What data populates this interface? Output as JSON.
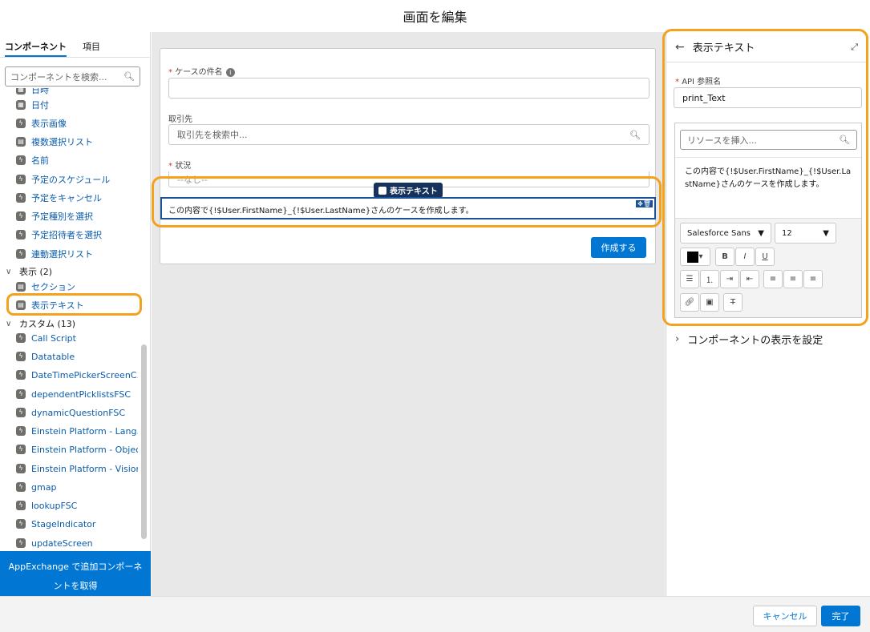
{
  "header": {
    "title": "画面を編集"
  },
  "left": {
    "tabs": [
      "コンポーネント",
      "項目"
    ],
    "search_placeholder": "コンポーネントを検索...",
    "items": [
      {
        "label": "日時"
      },
      {
        "label": "日付"
      },
      {
        "label": "表示画像"
      },
      {
        "label": "複数選択リスト"
      },
      {
        "label": "名前"
      },
      {
        "label": "予定のスケジュール"
      },
      {
        "label": "予定をキャンセル"
      },
      {
        "label": "予定種別を選択"
      },
      {
        "label": "予定招待者を選択"
      },
      {
        "label": "連動選択リスト"
      }
    ],
    "group_display": "表示 (2)",
    "display_items": [
      {
        "label": "セクション"
      },
      {
        "label": "表示テキスト"
      }
    ],
    "group_custom": "カスタム (13)",
    "custom_items": [
      {
        "label": "Call Script"
      },
      {
        "label": "Datatable"
      },
      {
        "label": "DateTimePickerScreenC..."
      },
      {
        "label": "dependentPicklistsFSC"
      },
      {
        "label": "dynamicQuestionFSC"
      },
      {
        "label": "Einstein Platform - Lang..."
      },
      {
        "label": "Einstein Platform - Objec..."
      },
      {
        "label": "Einstein Platform - Vision"
      },
      {
        "label": "gmap"
      },
      {
        "label": "lookupFSC"
      },
      {
        "label": "StageIndicator"
      },
      {
        "label": "updateScreen"
      }
    ],
    "appexchange": "AppExchange で追加コンポーネントを取得"
  },
  "canvas": {
    "case_subject_label": "ケースの件名",
    "account_label": "取引先",
    "account_placeholder": "取引先を検索中...",
    "status_label": "状況",
    "status_value": "--なし--",
    "pill": "表示テキスト",
    "display_text": "この内容で{!$User.FirstName}_{!$User.LastName}さんのケースを作成します。",
    "create_button": "作成する"
  },
  "right": {
    "title": "表示テキスト",
    "api_label": "API 参照名",
    "api_value": "print_Text",
    "resource_placeholder": "リソースを挿入...",
    "editor_text": "この内容で{!$User.FirstName}_{!$User.LastName}さんのケースを作成します。",
    "font": "Salesforce Sans",
    "size": "12",
    "section_toggle": "コンポーネントの表示を設定"
  },
  "footer": {
    "cancel": "キャンセル",
    "done": "完了"
  },
  "colors": {
    "accent": "#0176d3",
    "highlight": "#f4a11d"
  }
}
